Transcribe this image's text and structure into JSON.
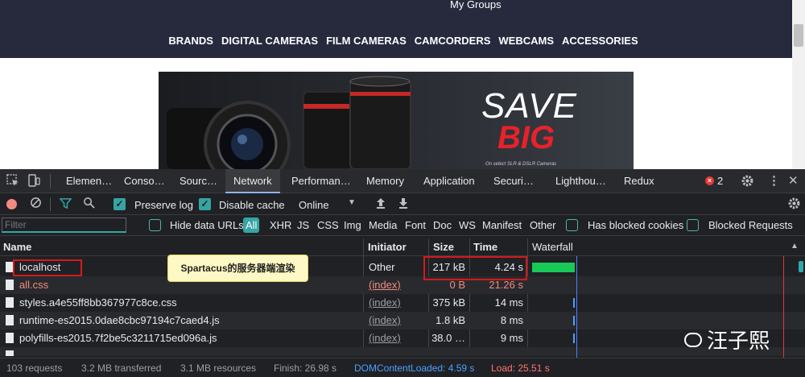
{
  "site": {
    "my_groups": "My Groups",
    "nav": [
      "BRANDS",
      "DIGITAL CAMERAS",
      "FILM CAMERAS",
      "CAMCORDERS",
      "WEBCAMS",
      "ACCESSORIES"
    ],
    "banner": {
      "save": "SAVE",
      "big": "BIG",
      "small": "On select SLR & DSLR Cameras"
    }
  },
  "devtools": {
    "tabs": [
      "Elemen…",
      "Conso…",
      "Sourc…",
      "Network",
      "Performan…",
      "Memory",
      "Application",
      "Securi…",
      "Lighthou…",
      "Redux"
    ],
    "active_tab": "Network",
    "error_count": "2",
    "toolbar": {
      "preserve_log": "Preserve log",
      "disable_cache": "Disable cache",
      "throttle": "Online"
    },
    "filter": {
      "placeholder": "Filter",
      "hide_data_urls": "Hide data URLs",
      "types": [
        "All",
        "XHR",
        "JS",
        "CSS",
        "Img",
        "Media",
        "Font",
        "Doc",
        "WS",
        "Manifest",
        "Other"
      ],
      "has_blocked_cookies": "Has blocked cookies",
      "blocked_requests": "Blocked Requests"
    },
    "columns": {
      "name": "Name",
      "initiator": "Initiator",
      "size": "Size",
      "time": "Time",
      "waterfall": "Waterfall"
    },
    "rows": [
      {
        "name": "localhost",
        "initiator": "Other",
        "size": "217 kB",
        "time": "4.24 s"
      },
      {
        "name": "all.css",
        "initiator": "(index)",
        "size": "0 B",
        "time": "21.26 s"
      },
      {
        "name": "styles.a4e55ff8bb367977c8ce.css",
        "initiator": "(index)",
        "size": "375 kB",
        "time": "14 ms"
      },
      {
        "name": "runtime-es2015.0dae8cbc97194c7caed4.js",
        "initiator": "(index)",
        "size": "1.8 kB",
        "time": "8 ms"
      },
      {
        "name": "polyfills-es2015.7f2be5c3211715ed096a.js",
        "initiator": "(index)",
        "size": "38.0 …",
        "time": "9 ms"
      }
    ],
    "status": {
      "requests": "103 requests",
      "transferred": "3.2 MB transferred",
      "resources": "3.1 MB resources",
      "finish": "Finish: 26.98 s",
      "dcl": "DOMContentLoaded: 4.59 s",
      "load": "Load: 25.51 s"
    }
  },
  "annotation": {
    "tooltip": "Spartacus的服务器端渲染"
  },
  "watermark": "汪子熙",
  "colors": {
    "accent": "#36a4a4",
    "error": "#d31a1a",
    "header_bg": "#262a3c",
    "sale": "#e8212b"
  }
}
